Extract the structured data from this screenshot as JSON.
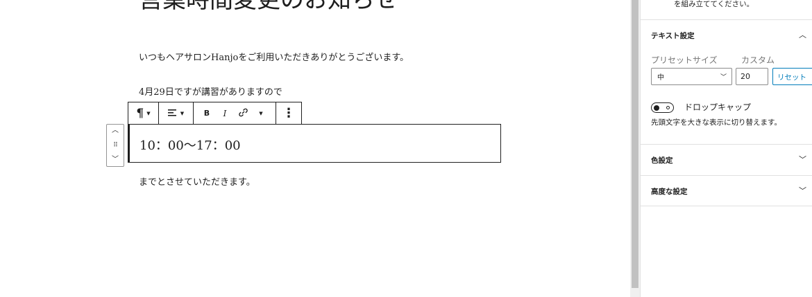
{
  "editor": {
    "title": "営業時間変更のお知らせ",
    "paragraphs": {
      "p1": "いつもヘアサロンHanjoをご利用いただきありがとうございます。",
      "p2": "4月29日ですが講習がありますので",
      "selected_block": "10：00〜17：00",
      "p4": "までとさせていただきます。"
    },
    "toolbar": {
      "paragraph_icon": "¶",
      "align_icon": "≡",
      "bold_label": "B",
      "italic_label": "I",
      "link_icon": "link-icon",
      "more_icon": "⋮"
    }
  },
  "sidebar": {
    "top_description": "を組み立ててください。",
    "text_settings": {
      "title": "テキスト設定",
      "preset_label": "プリセットサイズ",
      "custom_label": "カスタム",
      "preset_value": "中",
      "custom_value": "20",
      "reset_label": "リセット",
      "dropcap_label": "ドロップキャップ",
      "dropcap_help": "先頭文字を大きな表示に切り替えます。",
      "dropcap_enabled": false
    },
    "color_settings": {
      "title": "色設定"
    },
    "advanced_settings": {
      "title": "高度な設定"
    }
  }
}
